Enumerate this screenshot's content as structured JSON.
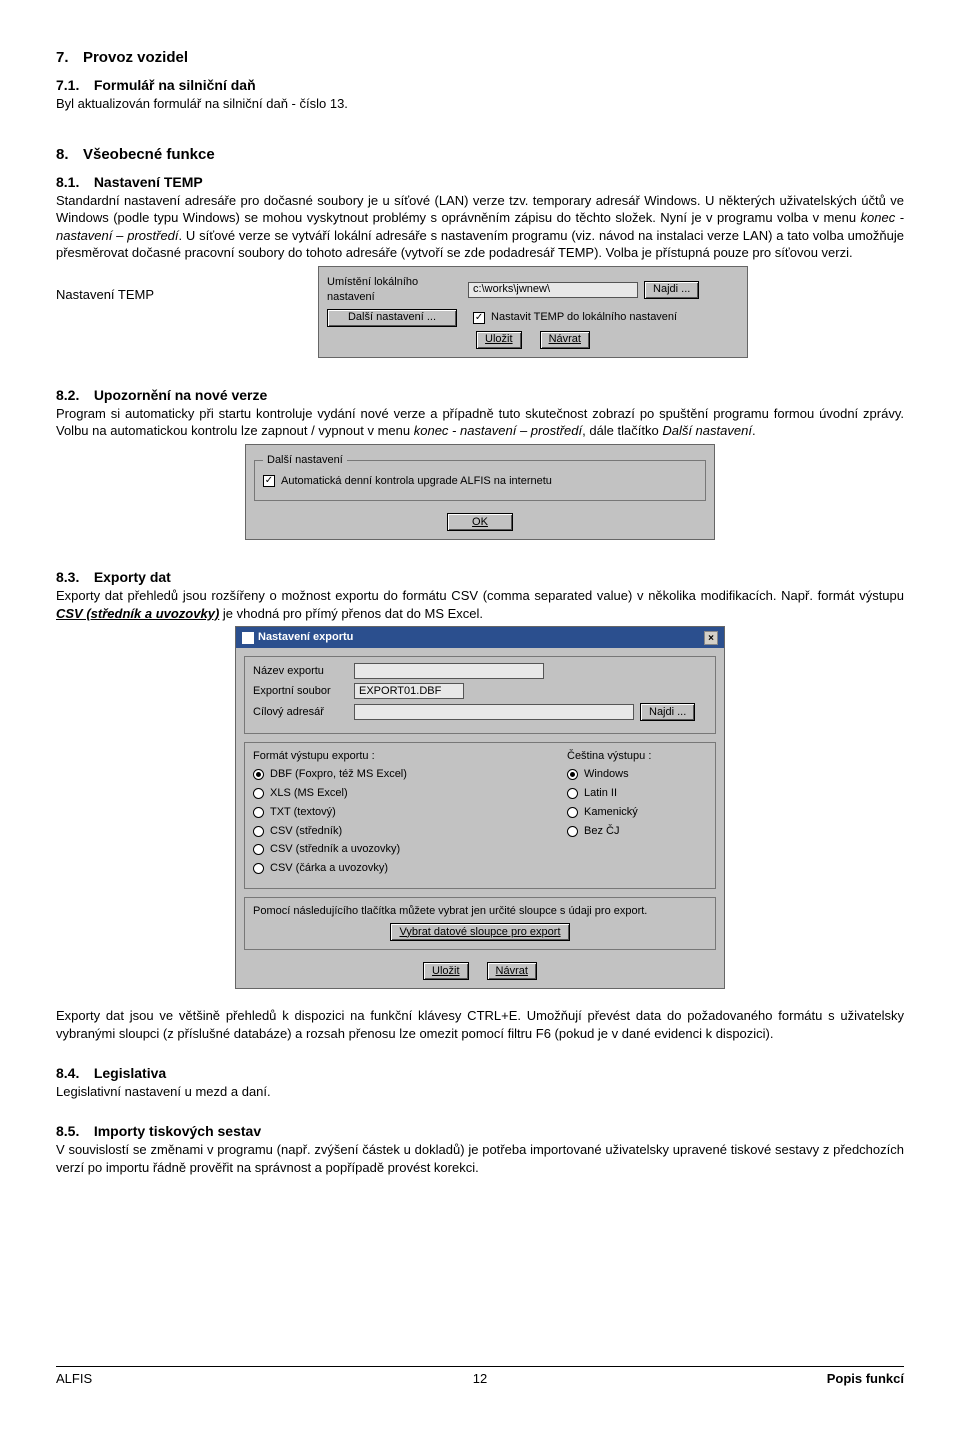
{
  "s7": {
    "num": "7.",
    "title": "Provoz vozidel"
  },
  "s71": {
    "num": "7.1.",
    "title": "Formulář na silniční daň",
    "body": "Byl aktualizován formulář na silniční daň - číslo 13."
  },
  "s8": {
    "num": "8.",
    "title": "Všeobecné funkce"
  },
  "s81": {
    "num": "8.1.",
    "title": "Nastavení TEMP",
    "body1": "Standardní nastavení adresáře pro dočasné soubory je u síťové (LAN) verze tzv. temporary adresář Windows. U některých uživatelských účtů ve Windows (podle typu Windows) se mohou vyskytnout problémy s oprávněním zápisu do těchto složek. Nyní je v programu volba v menu ",
    "body1_ital": "konec - nastavení – prostředí",
    "body1b": ". U síťové verze se vytváří lokální adresáře s nastavením programu (viz. návod na instalaci verze LAN) a tato volba umožňuje přesměrovat dočasné pracovní soubory do tohoto adresáře (vytvoří se zde podadresář TEMP). Volba je přístupná pouze pro síťovou verzi.",
    "sidelabel": "Nastavení TEMP"
  },
  "dlg1": {
    "lbl_path": "Umístění lokálního nastavení",
    "val_path": "c:\\works\\jwnew\\",
    "btn_najdi": "Najdi ...",
    "btn_dalsi": "Další nastavení ...",
    "chk_temp": "Nastavit TEMP do lokálního nastavení",
    "btn_ulozit": "Uložit",
    "btn_navrat": "Návrat"
  },
  "s82": {
    "num": "8.2.",
    "title": "Upozornění na nové verze",
    "body1": "Program si automaticky při startu kontroluje vydání nové verze a případně tuto skutečnost zobrazí po spuštění programu formou úvodní zprávy. Volbu na automatickou kontrolu lze zapnout / vypnout v menu ",
    "body1_ital": "konec - nastavení – prostředí",
    "body1b": ", dále tlačítko ",
    "body1_ital2": "Další nastavení",
    "body1c": "."
  },
  "dlg2": {
    "legend": "Další nastavení",
    "chk_auto": "Automatická denní kontrola upgrade ALFIS na internetu",
    "btn_ok": "OK"
  },
  "s83": {
    "num": "8.3.",
    "title": "Exporty dat",
    "body1": "Exporty dat přehledů jsou rozšířeny o možnost exportu do formátu CSV (comma separated value) v několika modifikacích. Např. formát výstupu ",
    "body1_bold": "CSV (středník a uvozovky)",
    "body1b": " je vhodná pro přímý přenos dat do MS Excel."
  },
  "dlg3": {
    "title": "Nastavení exportu",
    "lbl_nazev": "Název exportu",
    "val_nazev": "",
    "lbl_soubor": "Exportní soubor",
    "val_soubor": "EXPORT01.DBF",
    "lbl_cilovy": "Cílový adresář",
    "val_cilovy": "",
    "btn_najdi": "Najdi ...",
    "grp_format": "Formát výstupu exportu :",
    "fmt": [
      "DBF (Foxpro, též MS Excel)",
      "XLS (MS Excel)",
      "TXT (textový)",
      "CSV (středník)",
      "CSV (středník a uvozovky)",
      "CSV (čárka a uvozovky)"
    ],
    "grp_cestina": "Čeština výstupu :",
    "enc": [
      "Windows",
      "Latin II",
      "Kamenický",
      "Bez ČJ"
    ],
    "help": "Pomocí následujícího tlačítka můžete vybrat jen určité sloupce s údaji pro export.",
    "btn_cols": "Vybrat datové sloupce pro export",
    "btn_ulozit": "Uložit",
    "btn_navrat": "Návrat"
  },
  "s83after": "Exporty dat jsou ve většině přehledů k dispozici na funkční klávesy CTRL+E. Umožňují převést data do požadovaného formátu s uživatelsky vybranými sloupci (z příslušné databáze) a rozsah přenosu lze omezit pomocí filtru F6 (pokud je v dané evidenci k dispozici).",
  "s84": {
    "num": "8.4.",
    "title": "Legislativa",
    "body": "Legislativní nastavení u mezd a daní."
  },
  "s85": {
    "num": "8.5.",
    "title": "Importy tiskových sestav",
    "body": "V souvislostí se změnami v programu (např. zvýšení částek u dokladů) je potřeba importované uživatelsky upravené tiskové sestavy z předchozích verzí po importu řádně prověřit na správnost a popřípadě provést korekci."
  },
  "footer": {
    "left": "ALFIS",
    "page": "12",
    "right": "Popis funkcí"
  }
}
